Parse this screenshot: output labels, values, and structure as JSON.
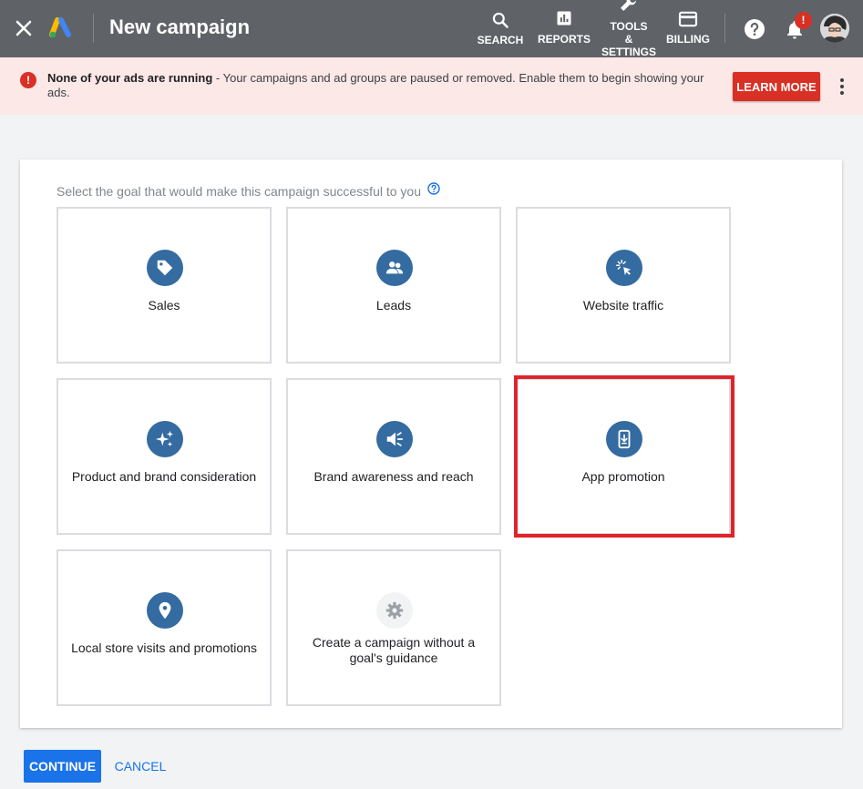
{
  "header": {
    "title": "New campaign",
    "nav": {
      "search": "SEARCH",
      "reports": "REPORTS",
      "tools_line1": "TOOLS",
      "tools_line2": "&",
      "tools_line3": "SETTINGS",
      "billing": "BILLING"
    },
    "notification_badge": "!"
  },
  "alert": {
    "icon_text": "!",
    "title": "None of your ads are running",
    "message": " - Your campaigns and ad groups are paused or removed. Enable them to begin showing your ads.",
    "button": "LEARN MORE"
  },
  "main": {
    "instruction": "Select the goal that would make this campaign successful to you",
    "goals": [
      {
        "label": "Sales",
        "icon": "tag-icon"
      },
      {
        "label": "Leads",
        "icon": "people-icon"
      },
      {
        "label": "Website traffic",
        "icon": "cursor-click-icon"
      },
      {
        "label": "Product and brand consideration",
        "icon": "sparkle-icon"
      },
      {
        "label": "Brand awareness and reach",
        "icon": "speaker-icon"
      },
      {
        "label": "App promotion",
        "icon": "mobile-download-icon"
      },
      {
        "label": "Local store visits and promotions",
        "icon": "location-pin-icon"
      },
      {
        "label": "Create a campaign without a goal's guidance",
        "icon": "gear-icon"
      }
    ],
    "highlighted_goal": "App promotion"
  },
  "footer": {
    "continue": "CONTINUE",
    "cancel": "CANCEL"
  },
  "colors": {
    "topbar": "#5f6368",
    "alert_bg": "#fce8e6",
    "alert_red": "#d93025",
    "icon_blue": "#346ba0",
    "primary": "#1a73e8",
    "highlight": "#e0242b"
  }
}
